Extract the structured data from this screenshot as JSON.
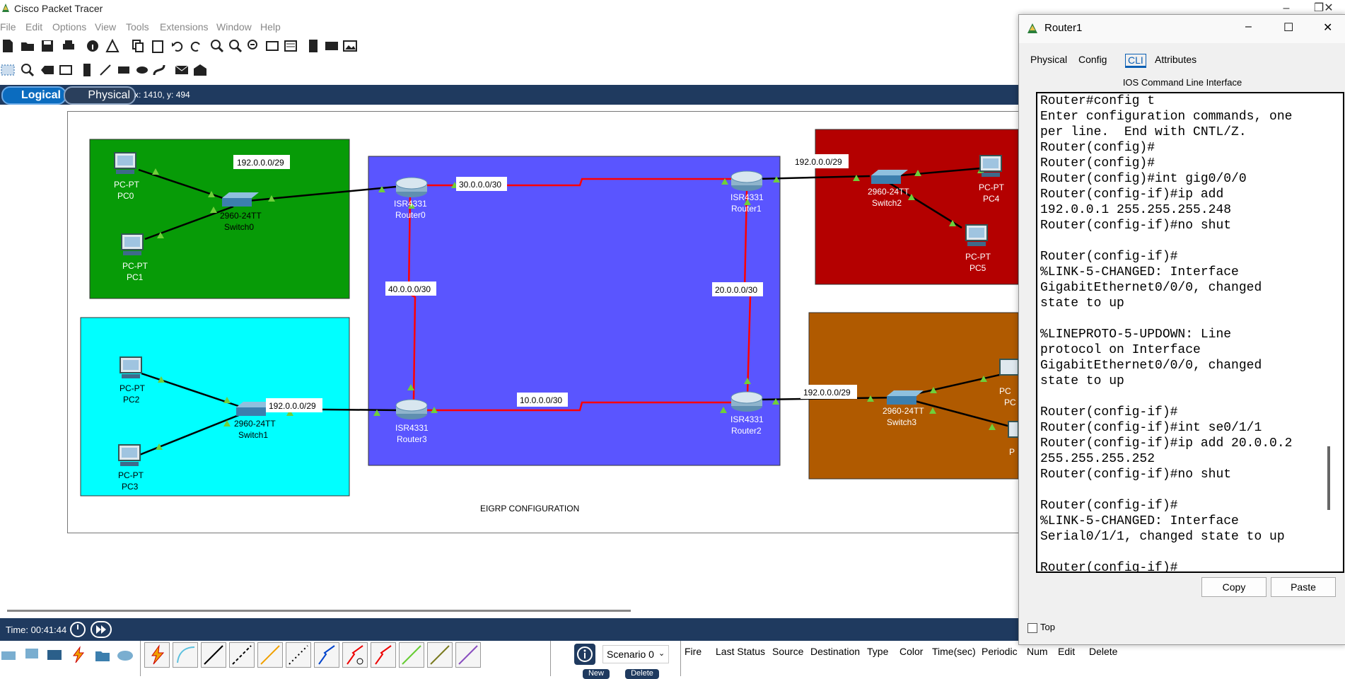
{
  "app": {
    "title": "Cisco Packet Tracer"
  },
  "menu": [
    "File",
    "Edit",
    "Options",
    "View",
    "Tools",
    "Extensions",
    "Window",
    "Help"
  ],
  "mode_tabs": {
    "logical": "Logical",
    "physical": "Physical"
  },
  "coords": "x: 1410, y: 494",
  "topology": {
    "title": "EIGRP CONFIGURATION",
    "zone_colors": {
      "green": "#079b07",
      "cyan": "#00ffff",
      "blue": "#5a55ff",
      "red": "#b40000",
      "brown": "#b05a00"
    },
    "devices": [
      {
        "model": "PC-PT",
        "name": "PC0"
      },
      {
        "model": "PC-PT",
        "name": "PC1"
      },
      {
        "model": "2960-24TT",
        "name": "Switch0"
      },
      {
        "model": "PC-PT",
        "name": "PC2"
      },
      {
        "model": "PC-PT",
        "name": "PC3"
      },
      {
        "model": "2960-24TT",
        "name": "Switch1"
      },
      {
        "model": "ISR4331",
        "name": "Router0"
      },
      {
        "model": "ISR4331",
        "name": "Router3"
      },
      {
        "model": "ISR4331",
        "name": "Router1"
      },
      {
        "model": "ISR4331",
        "name": "Router2"
      },
      {
        "model": "2960-24TT",
        "name": "Switch2"
      },
      {
        "model": "PC-PT",
        "name": "PC4"
      },
      {
        "model": "PC-PT",
        "name": "PC5"
      },
      {
        "model": "2960-24TT",
        "name": "Switch3"
      },
      {
        "model": "PC",
        "name": "PC"
      },
      {
        "model": "P",
        "name": "P"
      }
    ],
    "networks": [
      "192.0.0.0/29",
      "192.0.0.0/29",
      "30.0.0.0/30",
      "40.0.0.0/30",
      "10.0.0.0/30",
      "20.0.0.0/30",
      "192.0.0.0/29",
      "192.0.0.0/29"
    ]
  },
  "timebar": {
    "time": "Time: 00:41:44"
  },
  "scenario": {
    "selected": "Scenario 0",
    "new_label": "New",
    "delete_label": "Delete"
  },
  "pdu_columns": [
    "Fire",
    "Last Status",
    "Source",
    "Destination",
    "Type",
    "Color",
    "Time(sec)",
    "Periodic",
    "Num",
    "Edit",
    "Delete"
  ],
  "dialog": {
    "title": "Router1",
    "tabs": [
      "Physical",
      "Config",
      "CLI",
      "Attributes"
    ],
    "active_tab": "CLI",
    "heading": "IOS Command Line Interface",
    "cli_text": "Router#config t\nEnter configuration commands, one\nper line.  End with CNTL/Z.\nRouter(config)#\nRouter(config)#\nRouter(config)#int gig0/0/0\nRouter(config-if)#ip add\n192.0.0.1 255.255.255.248\nRouter(config-if)#no shut\n\nRouter(config-if)#\n%LINK-5-CHANGED: Interface\nGigabitEthernet0/0/0, changed\nstate to up\n\n%LINEPROTO-5-UPDOWN: Line\nprotocol on Interface\nGigabitEthernet0/0/0, changed\nstate to up\n\nRouter(config-if)#\nRouter(config-if)#int se0/1/1\nRouter(config-if)#ip add 20.0.0.2\n255.255.255.252\nRouter(config-if)#no shut\n\nRouter(config-if)#\n%LINK-5-CHANGED: Interface\nSerial0/1/1, changed state to up\n\nRouter(config-if)#",
    "copy_label": "Copy",
    "paste_label": "Paste",
    "top_label": "Top"
  }
}
